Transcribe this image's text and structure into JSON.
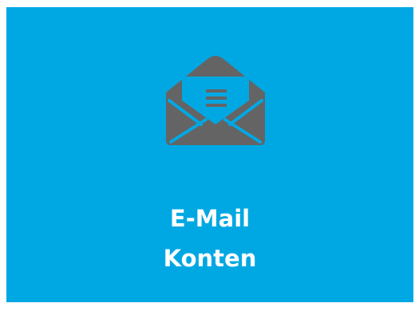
{
  "tile": {
    "title_line1": "E-Mail",
    "title_line2": "Konten",
    "icon": "open-envelope-icon",
    "background_color": "#00a8e3",
    "icon_color": "#646464",
    "text_color": "#ffffff"
  }
}
